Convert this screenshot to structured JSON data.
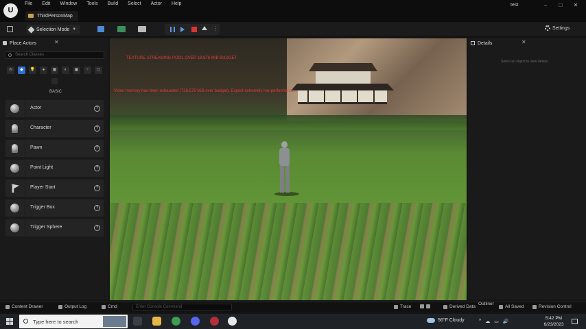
{
  "window": {
    "logo": "U",
    "menu": [
      "File",
      "Edit",
      "Window",
      "Tools",
      "Build",
      "Select",
      "Actor",
      "Help"
    ],
    "map_tab": "ThirdPersonMap",
    "project_name": "test",
    "controls": [
      "–",
      "□",
      "✕"
    ]
  },
  "toolbar": {
    "mode_label": "Selection Mode",
    "more": "⋮",
    "settings_label": "Settings"
  },
  "place_actors": {
    "tab_label": "Place Actors",
    "close": "✕",
    "search_placeholder": "Search Classes",
    "categories": [
      "◷",
      "◆",
      "💡",
      "●",
      "▦",
      "◐",
      "▣",
      "⁘",
      "▢"
    ],
    "section_label": "BASIC",
    "items": [
      {
        "label": "Actor",
        "icon": "sphere-icon"
      },
      {
        "label": "Character",
        "icon": "figure-icon"
      },
      {
        "label": "Pawn",
        "icon": "pawn-icon"
      },
      {
        "label": "Point Light",
        "icon": "light-icon"
      },
      {
        "label": "Player Start",
        "icon": "flag-icon"
      },
      {
        "label": "Trigger Box",
        "icon": "box-icon"
      },
      {
        "label": "Trigger Sphere",
        "icon": "sphere-icon"
      }
    ],
    "help": "?"
  },
  "viewport": {
    "msg1": "TEXTURE STREAMING POOL OVER 18.876 MIB BUDGET",
    "msg2": "Video memory has been exhausted (728.578 MiB over budget). Expect extremely low performance."
  },
  "details": {
    "tab_label": "Details",
    "close": "✕",
    "hint": "Select an object to view details."
  },
  "statusbar": {
    "content_drawer": "Content Drawer",
    "output_log": "Output Log",
    "cmd": "Cmd",
    "cmd_placeholder": "Enter Console Command",
    "trace": "Trace",
    "derived_data": "Derived Data",
    "outliner": "Outliner",
    "all_saved": "All Saved",
    "revision_control": "Revision Control"
  },
  "taskbar": {
    "search_placeholder": "Type here to search",
    "weather": "56°F  Cloudy",
    "tray": [
      "^",
      "☁",
      "▭",
      "🔊"
    ],
    "time": "5:42 PM",
    "date": "6/23/2023"
  },
  "colors": {
    "accent": "#2e6fd0",
    "stop": "#dd3333",
    "warning_text": "#e23a3a"
  }
}
